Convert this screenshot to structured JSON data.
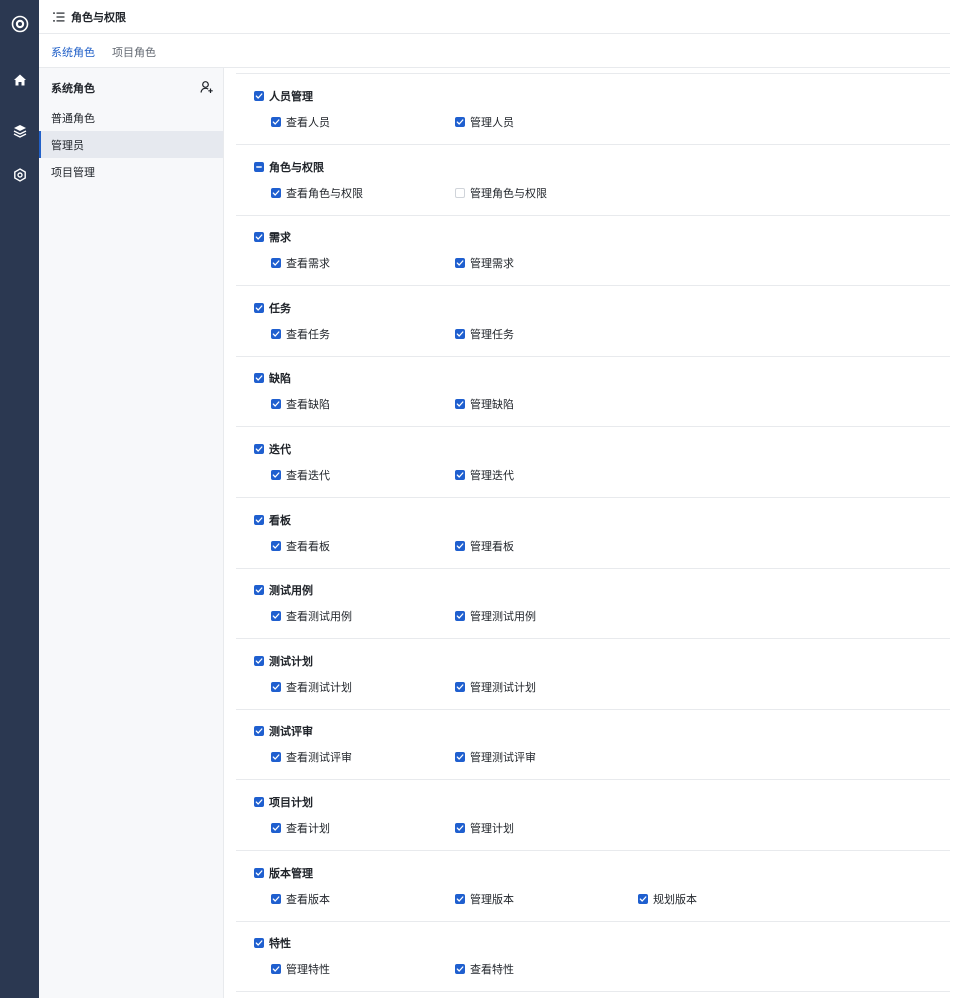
{
  "header": {
    "title": "角色与权限"
  },
  "tabs": [
    {
      "label": "系统角色",
      "active": true
    },
    {
      "label": "项目角色",
      "active": false
    }
  ],
  "role_panel": {
    "title": "系统角色",
    "roles": [
      {
        "label": "普通角色",
        "active": false
      },
      {
        "label": "管理员",
        "active": true
      },
      {
        "label": "项目管理",
        "active": false
      }
    ]
  },
  "permissions": [
    {
      "label": "人员管理",
      "state": "checked",
      "items": [
        {
          "label": "查看人员",
          "checked": true
        },
        {
          "label": "管理人员",
          "checked": true
        }
      ]
    },
    {
      "label": "角色与权限",
      "state": "indeterminate",
      "items": [
        {
          "label": "查看角色与权限",
          "checked": true
        },
        {
          "label": "管理角色与权限",
          "checked": false
        }
      ]
    },
    {
      "label": "需求",
      "state": "checked",
      "items": [
        {
          "label": "查看需求",
          "checked": true
        },
        {
          "label": "管理需求",
          "checked": true
        }
      ]
    },
    {
      "label": "任务",
      "state": "checked",
      "items": [
        {
          "label": "查看任务",
          "checked": true
        },
        {
          "label": "管理任务",
          "checked": true
        }
      ]
    },
    {
      "label": "缺陷",
      "state": "checked",
      "items": [
        {
          "label": "查看缺陷",
          "checked": true
        },
        {
          "label": "管理缺陷",
          "checked": true
        }
      ]
    },
    {
      "label": "迭代",
      "state": "checked",
      "items": [
        {
          "label": "查看迭代",
          "checked": true
        },
        {
          "label": "管理迭代",
          "checked": true
        }
      ]
    },
    {
      "label": "看板",
      "state": "checked",
      "items": [
        {
          "label": "查看看板",
          "checked": true
        },
        {
          "label": "管理看板",
          "checked": true
        }
      ]
    },
    {
      "label": "测试用例",
      "state": "checked",
      "items": [
        {
          "label": "查看测试用例",
          "checked": true
        },
        {
          "label": "管理测试用例",
          "checked": true
        }
      ]
    },
    {
      "label": "测试计划",
      "state": "checked",
      "items": [
        {
          "label": "查看测试计划",
          "checked": true
        },
        {
          "label": "管理测试计划",
          "checked": true
        }
      ]
    },
    {
      "label": "测试评审",
      "state": "checked",
      "items": [
        {
          "label": "查看测试评审",
          "checked": true
        },
        {
          "label": "管理测试评审",
          "checked": true
        }
      ]
    },
    {
      "label": "项目计划",
      "state": "checked",
      "items": [
        {
          "label": "查看计划",
          "checked": true
        },
        {
          "label": "管理计划",
          "checked": true
        }
      ]
    },
    {
      "label": "版本管理",
      "state": "checked",
      "items": [
        {
          "label": "查看版本",
          "checked": true
        },
        {
          "label": "管理版本",
          "checked": true
        },
        {
          "label": "规划版本",
          "checked": true
        }
      ]
    },
    {
      "label": "特性",
      "state": "checked",
      "items": [
        {
          "label": "管理特性",
          "checked": true
        },
        {
          "label": "查看特性",
          "checked": true
        }
      ]
    }
  ],
  "colors": {
    "rail": "#2b3851",
    "accent": "#1f5fcf",
    "active_role_bg": "#e6e9ef",
    "panel_bg": "#f7f8fa"
  },
  "icons": {
    "rail": [
      "logo-icon",
      "home-icon",
      "layers-icon",
      "settings-icon"
    ],
    "header": "menu-icon",
    "role_panel": "add-user-icon"
  }
}
